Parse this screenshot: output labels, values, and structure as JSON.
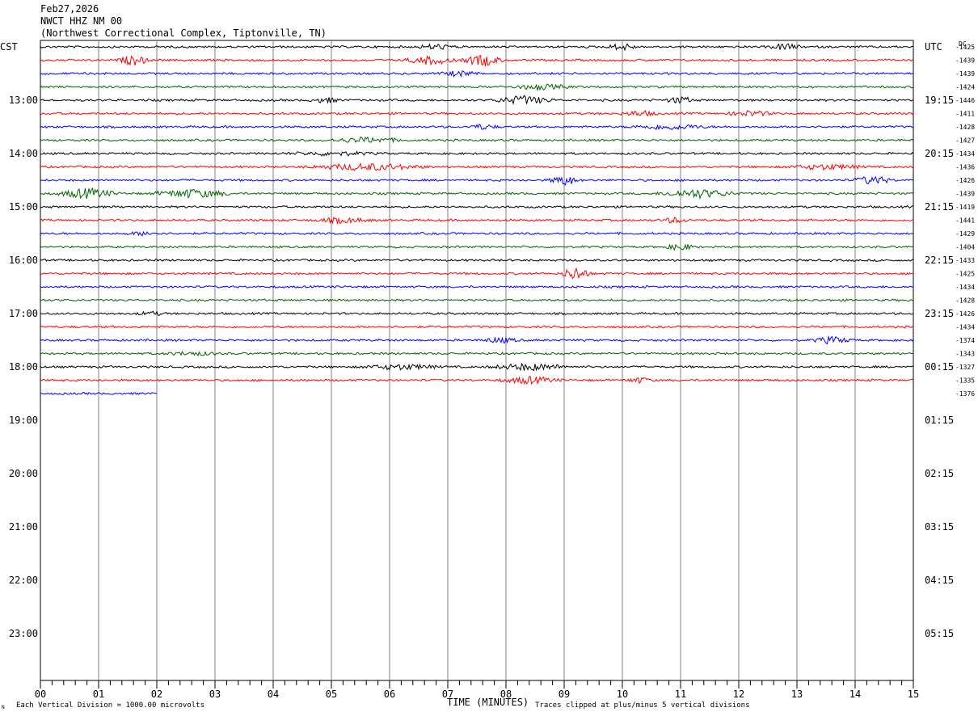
{
  "header": {
    "date": "Feb27,2026",
    "station": "NWCT HHZ NM 00",
    "site": "(Northwest Correctional Complex, Tiptonville, TN)"
  },
  "left_zone_label": "CST",
  "right_zone_label": "UTC",
  "dc_label": "DC",
  "corner_mark": "N",
  "footer": {
    "xaxis_title": "TIME (MINUTES)",
    "left_note": "Each Vertical Division = 1000.00 microvolts",
    "right_note": "Traces clipped at plus/minus 5 vertical divisions"
  },
  "colors": {
    "trace_cycle": [
      "#000000",
      "#ff0000",
      "#0000ff",
      "#006400"
    ],
    "grid": "#808080"
  },
  "chart_data": {
    "type": "line",
    "title": "",
    "xlabel": "TIME (MINUTES)",
    "xlim": [
      0,
      15
    ],
    "x_ticks": [
      "00",
      "01",
      "02",
      "03",
      "04",
      "05",
      "06",
      "07",
      "08",
      "09",
      "10",
      "11",
      "12",
      "13",
      "14",
      "15"
    ],
    "left_hour_labels": [
      "CST",
      "13:00",
      "14:00",
      "15:00",
      "16:00",
      "17:00",
      "18:00",
      "19:00",
      "20:00",
      "21:00",
      "22:00",
      "23:00"
    ],
    "right_hour_labels": [
      "UTC",
      "19:15",
      "20:15",
      "21:15",
      "22:15",
      "23:15",
      "00:15",
      "01:15",
      "02:15",
      "03:15",
      "04:15",
      "05:15"
    ],
    "traces_per_hour": 4,
    "minutes_per_trace": 15,
    "vertical_division_microvolts": 1000.0,
    "clip_divisions": 5,
    "traces": [
      {
        "dc": "-1425",
        "end_min": 15
      },
      {
        "dc": "-1439",
        "end_min": 15
      },
      {
        "dc": "-1439",
        "end_min": 15
      },
      {
        "dc": "-1424",
        "end_min": 15
      },
      {
        "dc": "-1446",
        "end_min": 15
      },
      {
        "dc": "-1411",
        "end_min": 15
      },
      {
        "dc": "-1428",
        "end_min": 15
      },
      {
        "dc": "-1427",
        "end_min": 15
      },
      {
        "dc": "-1434",
        "end_min": 15
      },
      {
        "dc": "-1436",
        "end_min": 15
      },
      {
        "dc": "-1426",
        "end_min": 15
      },
      {
        "dc": "-1439",
        "end_min": 15
      },
      {
        "dc": "-1419",
        "end_min": 15
      },
      {
        "dc": "-1441",
        "end_min": 15
      },
      {
        "dc": "-1429",
        "end_min": 15
      },
      {
        "dc": "-1404",
        "end_min": 15
      },
      {
        "dc": "-1433",
        "end_min": 15
      },
      {
        "dc": "-1425",
        "end_min": 15
      },
      {
        "dc": "-1434",
        "end_min": 15
      },
      {
        "dc": "-1428",
        "end_min": 15
      },
      {
        "dc": "-1426",
        "end_min": 15
      },
      {
        "dc": "-1434",
        "end_min": 15
      },
      {
        "dc": "-1374",
        "end_min": 15
      },
      {
        "dc": "-1343",
        "end_min": 15
      },
      {
        "dc": "-1327",
        "end_min": 15
      },
      {
        "dc": "-1335",
        "end_min": 15
      },
      {
        "dc": "-1376",
        "end_min": 2
      }
    ]
  }
}
